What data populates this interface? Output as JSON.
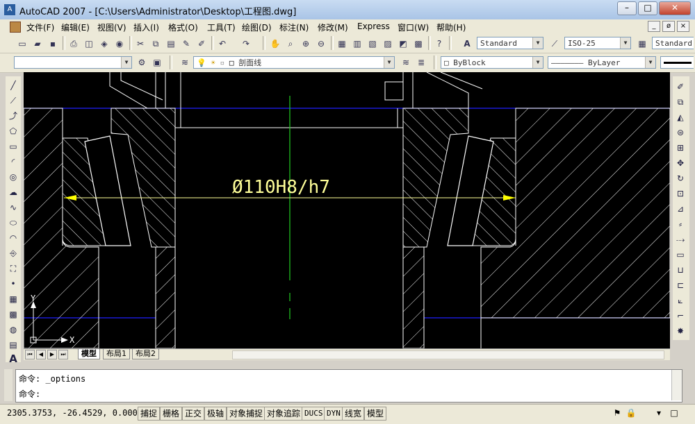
{
  "window": {
    "title": "AutoCAD 2007 - [C:\\Users\\Administrator\\Desktop\\工程图.dwg]",
    "app_icon": "A",
    "minimize": "–",
    "maximize": "□",
    "close": "✕"
  },
  "menu": {
    "items": [
      "文件(F)",
      "编辑(E)",
      "视图(V)",
      "插入(I)",
      "格式(O)",
      "工具(T)",
      "绘图(D)",
      "标注(N)",
      "修改(M)",
      "Express",
      "窗口(W)",
      "帮助(H)"
    ],
    "mdi_minimize": "_",
    "mdi_restore": "ø",
    "mdi_close": "×"
  },
  "toolbar": {
    "text_style": "Standard",
    "dim_style": "ISO-25",
    "table_style": "Standard",
    "text_style_icon": "A"
  },
  "layers": {
    "current_layer": "剖面线",
    "color": "ByBlock",
    "linetype": "ByLayer"
  },
  "drawing": {
    "dimension_text": "Ø110H8/h7",
    "ucs_x": "X",
    "ucs_y": "Y"
  },
  "layout_tabs": [
    "模型",
    "布局1",
    "布局2"
  ],
  "command": {
    "line1": "命令: _options",
    "line2": "命令:"
  },
  "status": {
    "coordinates": "2305.3753, -26.4529, 0.0000",
    "buttons": [
      "捕捉",
      "栅格",
      "正交",
      "极轴",
      "对象捕捉",
      "对象追踪",
      "DUCS",
      "DYN",
      "线宽",
      "模型"
    ]
  },
  "colors": {
    "canvas_bg": "#000000",
    "geometry": "#ffffff",
    "dimension": "#ffff99",
    "centerline": "#22cc22",
    "boundary": "#2020ff"
  }
}
